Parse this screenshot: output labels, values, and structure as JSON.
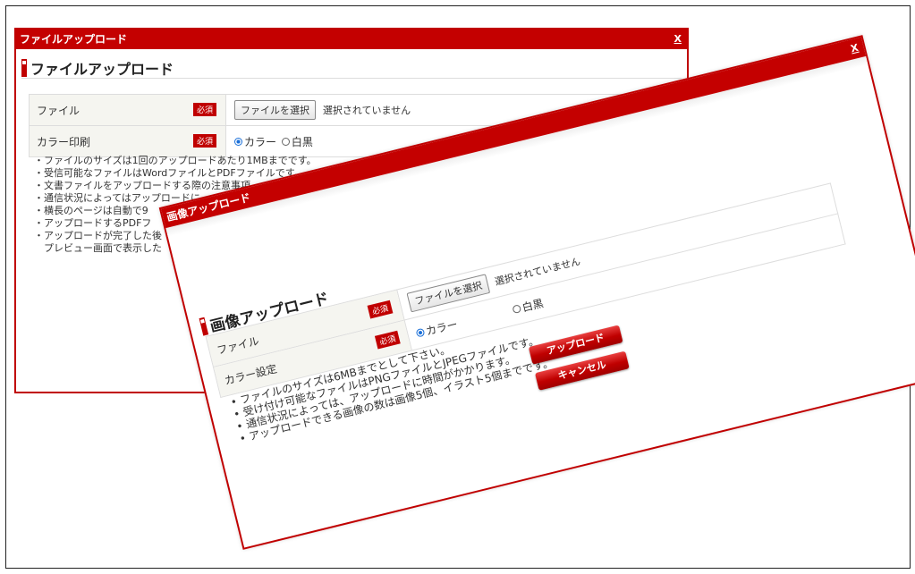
{
  "back_dialog": {
    "title": "ファイルアップロード",
    "close_label": "X",
    "heading": "ファイルアップロード",
    "rows": {
      "file": {
        "label": "ファイル",
        "required": "必須",
        "button": "ファイルを選択",
        "status": "選択されていません"
      },
      "color": {
        "label": "カラー印刷",
        "required": "必須",
        "options": [
          "カラー",
          "白黒"
        ],
        "selected": "カラー"
      }
    },
    "notes": [
      "・ファイルのサイズは1回のアップロードあたり1MBまでです。",
      "・受信可能なファイルはWordファイルとPDFファイルです。",
      "・文書ファイルをアップロードする際の注意事項",
      "・通信状況によってはアップロードに",
      "・横長のページは自動で9",
      "・アップロードするPDFフ",
      "・アップロードが完了した後",
      "　プレビュー画面で表示した"
    ]
  },
  "front_dialog": {
    "title": "画像アップロード",
    "close_label": "X",
    "heading": "画像アップロード",
    "rows": {
      "file": {
        "label": "ファイル",
        "required": "必須",
        "button": "ファイルを選択",
        "status": "選択されていません"
      },
      "color": {
        "label": "カラー設定",
        "required": "必須",
        "options": [
          "カラー",
          "白黒"
        ],
        "selected": "カラー"
      }
    },
    "notes": [
      "ファイルのサイズは6MBまでとして下さい。",
      "受け付け可能なファイルはPNGファイルとJPEGファイルです。",
      "通信状況によっては、アップロードに時間がかかります。",
      "アップロードできる画像の数は画像5個、イラスト5個までです。"
    ],
    "upload_button": "アップロード",
    "cancel_button": "キャンセル"
  },
  "colors": {
    "accent": "#c00000",
    "label_bg": "#f5f5f0"
  }
}
